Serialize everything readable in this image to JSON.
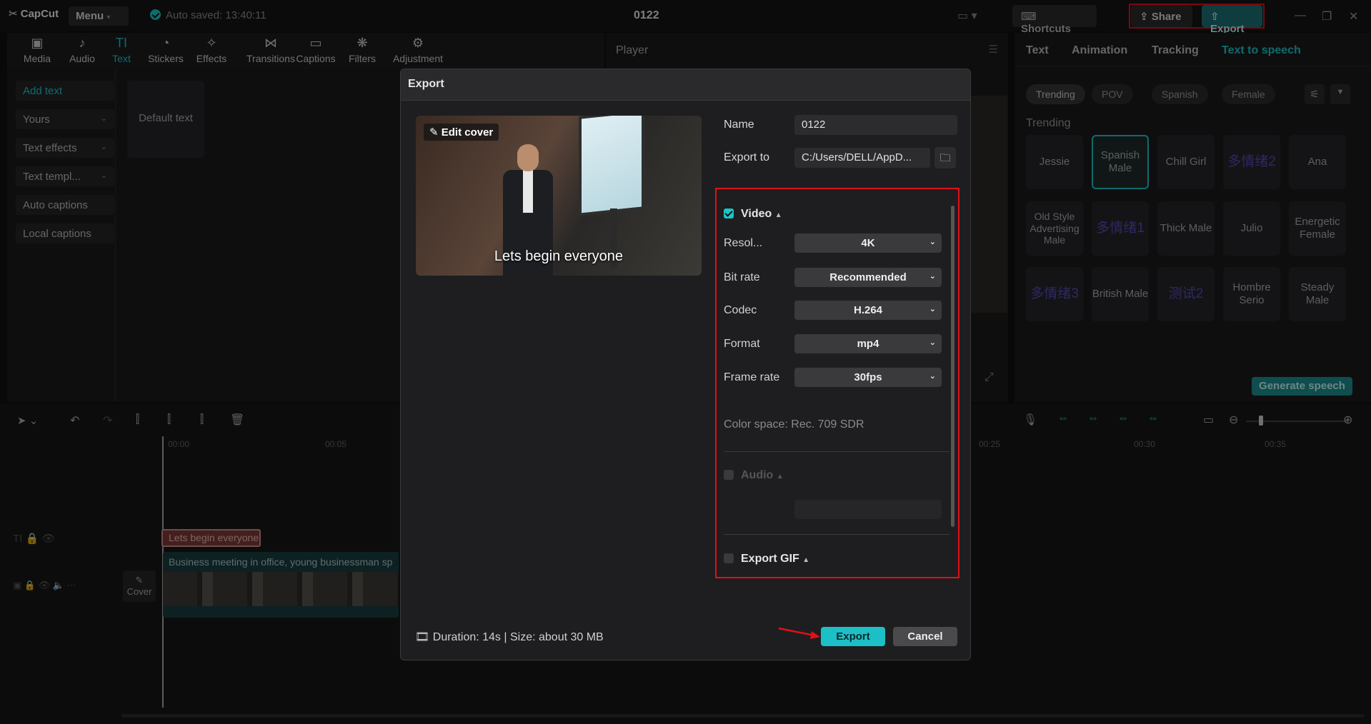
{
  "titlebar": {
    "logo": "CapCut",
    "menu": "Menu",
    "autosave": "Auto saved: 13:40:11",
    "project_name": "0122",
    "shortcuts": "Shortcuts",
    "share": "Share",
    "export": "Export"
  },
  "toolbar": {
    "tools": [
      "Media",
      "Audio",
      "Text",
      "Stickers",
      "Effects",
      "Transitions",
      "Captions",
      "Filters",
      "Adjustment"
    ],
    "active": "Text"
  },
  "sidebar": {
    "items": [
      "Add text",
      "Yours",
      "Text effects",
      "Text templ...",
      "Auto captions",
      "Local captions"
    ],
    "default_card": "Default text"
  },
  "player": {
    "title": "Player"
  },
  "right_panel": {
    "tabs": [
      "Text",
      "Animation",
      "Tracking",
      "Text to speech"
    ],
    "active_tab": "Text to speech",
    "chips": [
      "Trending",
      "POV",
      "Spanish",
      "Female"
    ],
    "section": "Trending",
    "voices": [
      "Jessie",
      "Spanish Male",
      "Chill Girl",
      "多情绪2",
      "Ana",
      "Old Style Advertising Male",
      "多情绪1",
      "Thick Male",
      "Julio",
      "Energetic Female",
      "多情绪3",
      "British Male",
      "测试2",
      "Hombre Serio",
      "Steady Male"
    ],
    "generate": "Generate speech"
  },
  "timeline": {
    "ruler": [
      "00:00",
      "00:05",
      "00:25",
      "00:30",
      "00:35"
    ],
    "text_clip": "Lets begin everyone",
    "video_clip": "Business meeting in office, young businessman sp",
    "cover": "Cover"
  },
  "dialog": {
    "title": "Export",
    "edit_cover": "Edit cover",
    "preview_caption": "Lets begin everyone",
    "name_label": "Name",
    "name_value": "0122",
    "export_to_label": "Export to",
    "export_to_value": "C:/Users/DELL/AppD...",
    "video_section": "Video",
    "resolution_label": "Resol...",
    "resolution_value": "4K",
    "bitrate_label": "Bit rate",
    "bitrate_value": "Recommended",
    "codec_label": "Codec",
    "codec_value": "H.264",
    "format_label": "Format",
    "format_value": "mp4",
    "framerate_label": "Frame rate",
    "framerate_value": "30fps",
    "color_space": "Color space: Rec. 709 SDR",
    "audio_section": "Audio",
    "gif_section": "Export GIF",
    "duration": "Duration: 14s | Size: about 30 MB",
    "export_button": "Export",
    "cancel_button": "Cancel"
  },
  "colors": {
    "accent": "#1dc4c8",
    "highlight": "#e0101a",
    "dialog_bg": "#1e1e20"
  }
}
